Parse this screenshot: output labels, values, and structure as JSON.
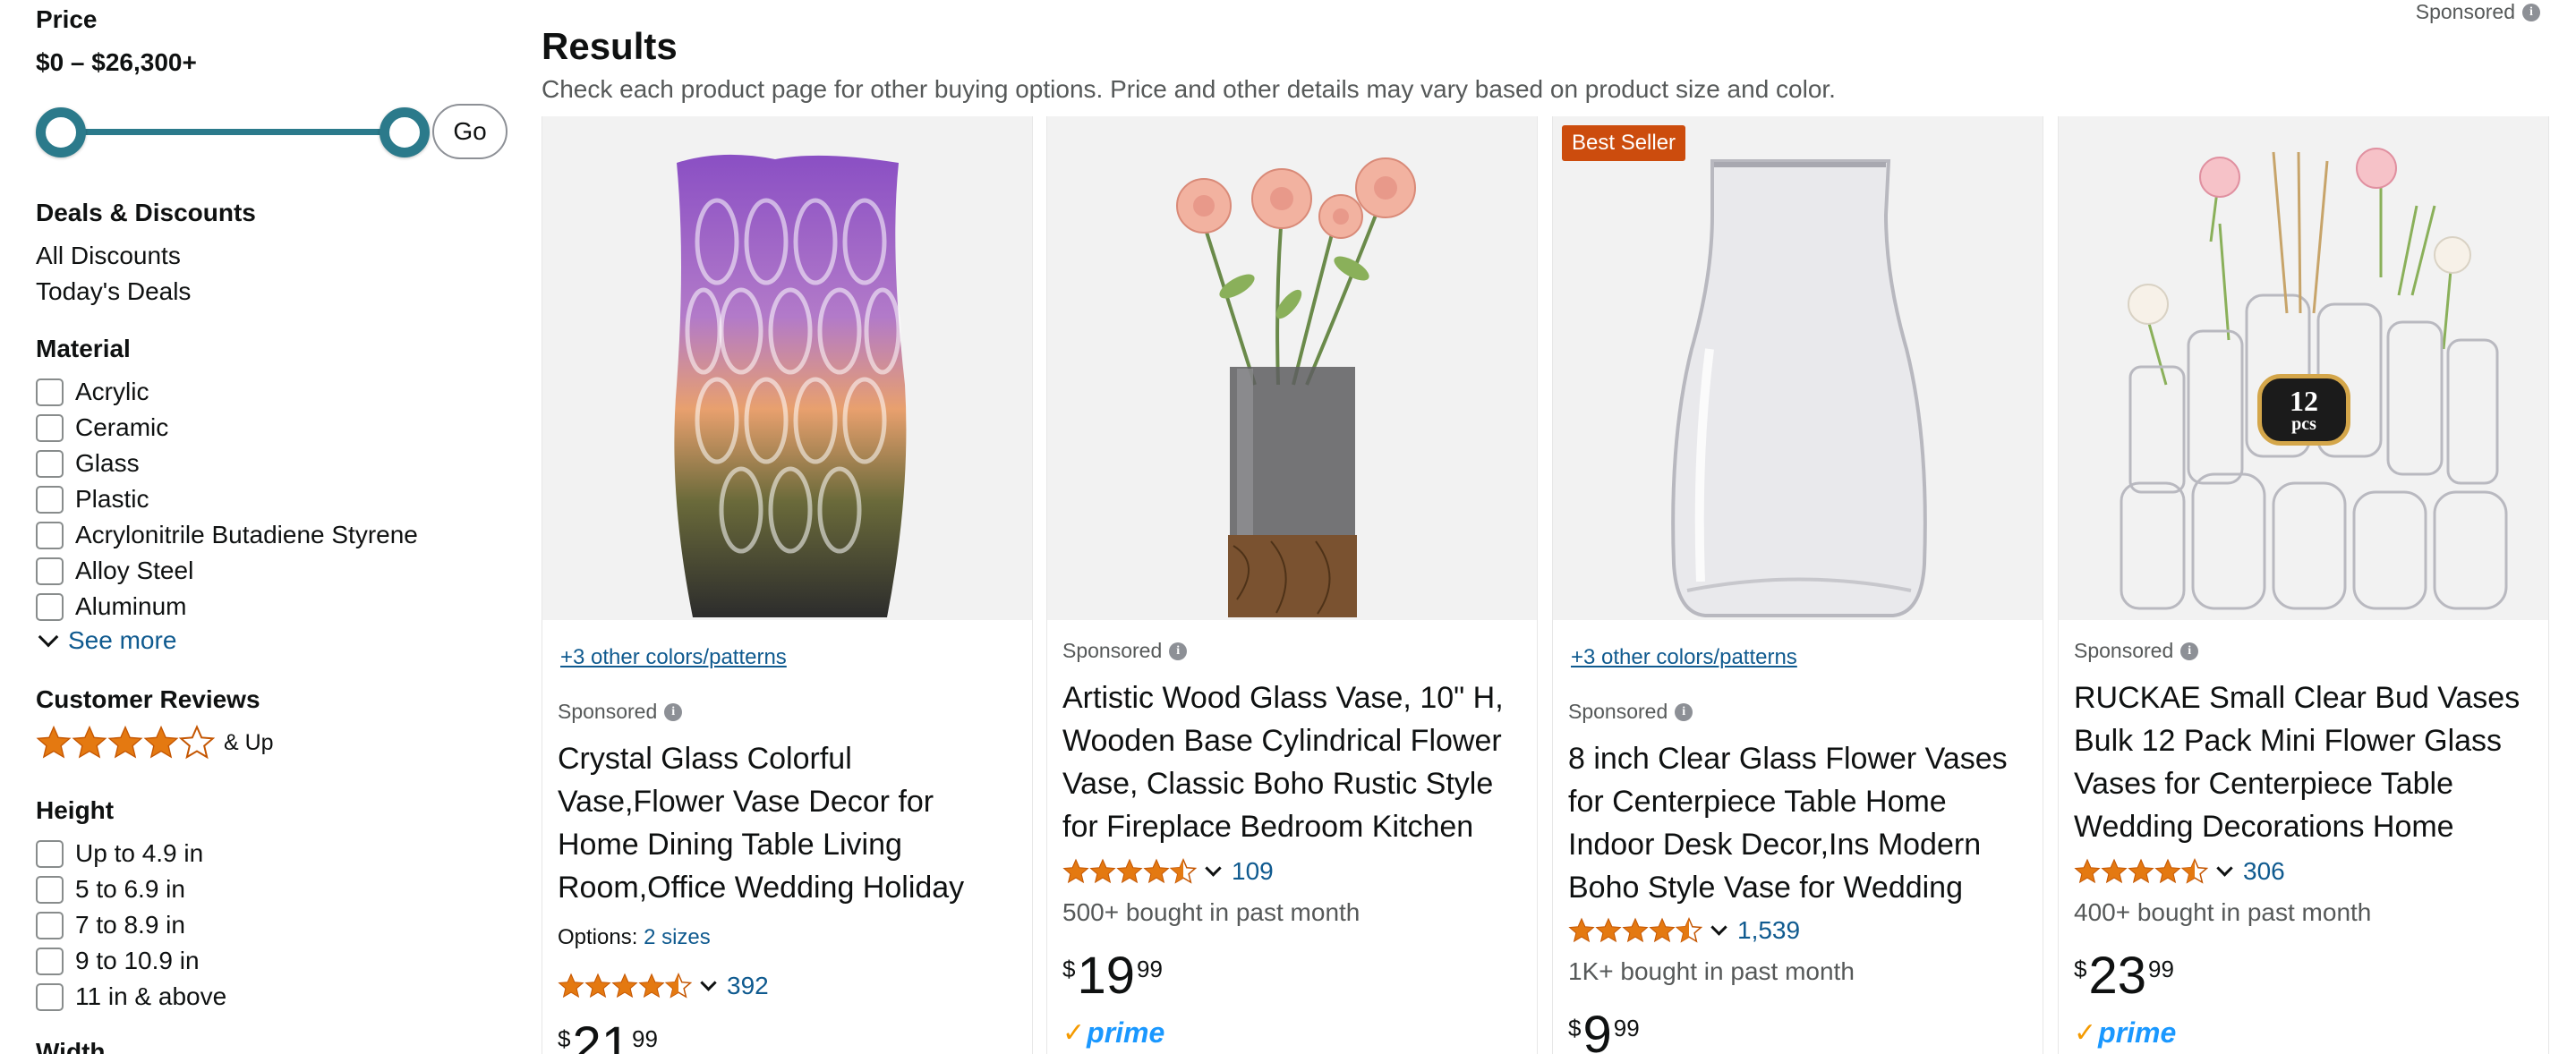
{
  "sidebar": {
    "price_heading": "Price",
    "price_range": "$0 – $26,300+",
    "slider": {
      "min_fraction": 0.0,
      "max_fraction": 1.0
    },
    "go_label": "Go",
    "deals_heading": "Deals & Discounts",
    "deals": [
      "All Discounts",
      "Today's Deals"
    ],
    "material_heading": "Material",
    "materials": [
      "Acrylic",
      "Ceramic",
      "Glass",
      "Plastic",
      "Acrylonitrile Butadiene Styrene",
      "Alloy Steel",
      "Aluminum"
    ],
    "see_more": "See more",
    "reviews_heading": "Customer Reviews",
    "reviews_stars": 4,
    "reviews_and_up": "& Up",
    "height_heading": "Height",
    "heights": [
      "Up to 4.9 in",
      "5 to 6.9 in",
      "7 to 8.9 in",
      "9 to 10.9 in",
      "11 in & above"
    ],
    "width_heading": "Width"
  },
  "header": {
    "title": "Results",
    "subtitle": "Check each product page for other buying options. Price and other details may vary based on product size and color.",
    "sponsored": "Sponsored"
  },
  "products": [
    {
      "colors_link": "+3 other colors/patterns",
      "sponsored": "Sponsored",
      "title": "Crystal Glass Colorful Vase,Flower Vase Decor for Home Dining Table Living Room,Office Wedding Holiday Party,Handmade…",
      "options_label": "Options:",
      "options_link": "2 sizes",
      "rating": 4.5,
      "rating_count": "392",
      "price_currency": "$",
      "price_whole": "21",
      "price_fraction": "99"
    },
    {
      "sponsored": "Sponsored",
      "title": "Artistic Wood Glass Vase, 10\" H, Wooden Base Cylindrical Flower Vase, Classic Boho Rustic Style for Fireplace Bedroom Kitchen Livin…",
      "rating": 4.5,
      "rating_count": "109",
      "bought": "500+ bought in past month",
      "price_currency": "$",
      "price_whole": "19",
      "price_fraction": "99",
      "prime": "prime"
    },
    {
      "badge": "Best Seller",
      "colors_link": "+3 other colors/patterns",
      "sponsored": "Sponsored",
      "title": "8 inch Clear Glass Flower Vases for Centerpiece Table Home Indoor Desk Decor,Ins Modern Boho Style Vase for Wedding Housewarmin…",
      "rating": 4.5,
      "rating_count": "1,539",
      "bought": "1K+ bought in past month",
      "price_currency": "$",
      "price_whole": "9",
      "price_fraction": "99"
    },
    {
      "sponsored": "Sponsored",
      "title": "RUCKAE Small Clear Bud Vases Bulk 12 Pack Mini Flower Glass Vases for Centerpiece Table Wedding Decorations Home Dec…",
      "image_badge_number": "12",
      "image_badge_unit": "pcs",
      "rating": 4.5,
      "rating_count": "306",
      "bought": "400+ bought in past month",
      "price_currency": "$",
      "price_whole": "23",
      "price_fraction": "99",
      "prime": "prime"
    }
  ],
  "colors": {
    "star": "#e47911",
    "link": "#0f5a8f",
    "badge": "#cc4c0d",
    "slider": "#2b7a8b",
    "prime": "#1a98ff"
  }
}
